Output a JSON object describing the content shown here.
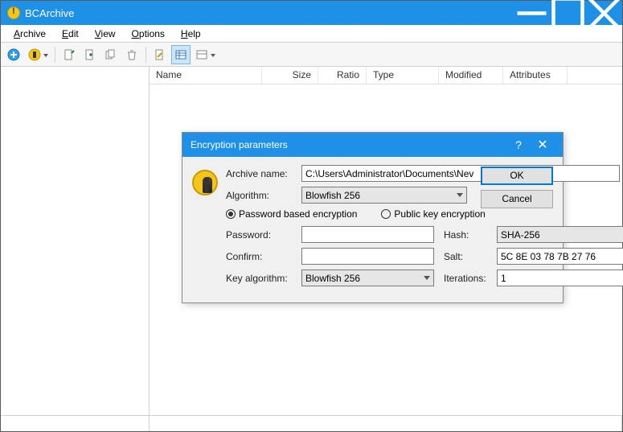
{
  "app": {
    "title": "BCArchive"
  },
  "menu": {
    "archive": "Archive",
    "edit": "Edit",
    "view": "View",
    "options": "Options",
    "help": "Help"
  },
  "columns": {
    "name": "Name",
    "size": "Size",
    "ratio": "Ratio",
    "type": "Type",
    "modified": "Modified",
    "attributes": "Attributes"
  },
  "dialog": {
    "title": "Encryption parameters",
    "labels": {
      "archive_name": "Archive name:",
      "algorithm": "Algorithm:",
      "password_radio": "Password based encryption",
      "publickey_radio": "Public key encryption",
      "password": "Password:",
      "confirm": "Confirm:",
      "key_algorithm": "Key algorithm:",
      "hash": "Hash:",
      "salt": "Salt:",
      "iterations": "Iterations:"
    },
    "values": {
      "archive_path": "C:\\Users\\Administrator\\Documents\\Nev",
      "algorithm": "Blowfish 256",
      "key_algorithm": "Blowfish 256",
      "hash": "SHA-256",
      "salt": "5C 8E 03 78 7B 27 76",
      "iterations": "1",
      "password": "",
      "confirm": ""
    },
    "buttons": {
      "ok": "OK",
      "cancel": "Cancel",
      "browse": "..."
    }
  }
}
